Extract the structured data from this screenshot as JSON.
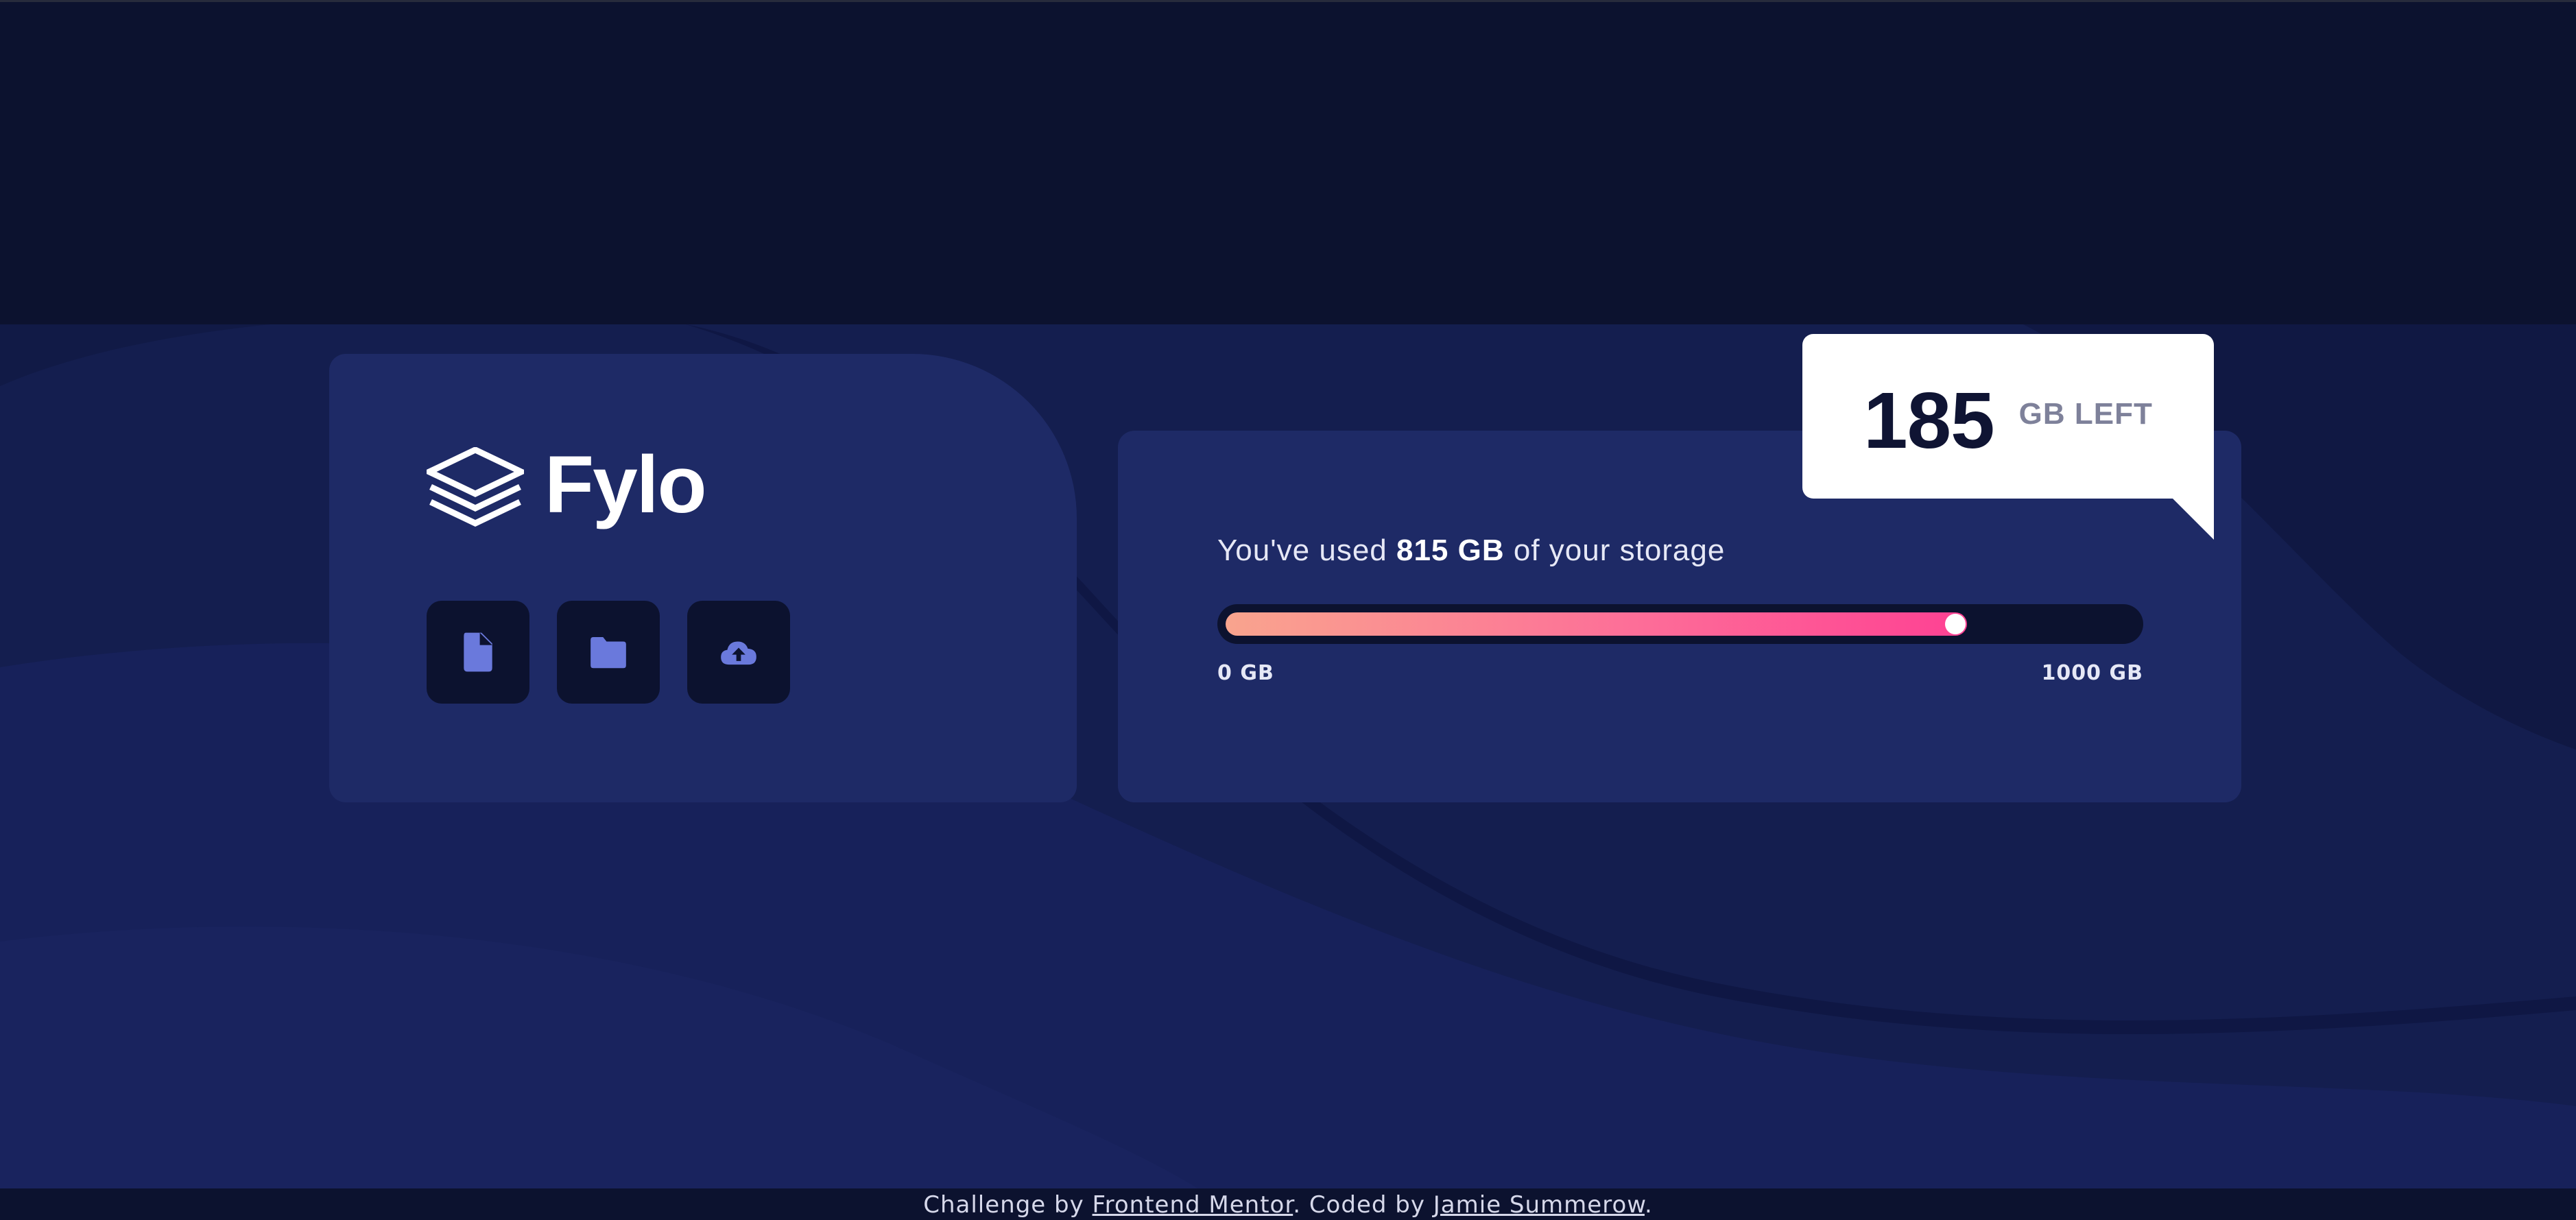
{
  "brand": {
    "name": "Fylo",
    "logo_icon": "stacked-layers-icon"
  },
  "actions": [
    {
      "name": "document",
      "icon": "document-icon"
    },
    {
      "name": "folder",
      "icon": "folder-icon"
    },
    {
      "name": "upload",
      "icon": "cloud-upload-icon"
    }
  ],
  "storage": {
    "used_prefix": "You've used ",
    "used_amount": "815 GB",
    "used_suffix": " of your storage",
    "used_fraction": 0.815,
    "min_label": "0 GB",
    "max_label": "1000 GB",
    "left_number": "185",
    "left_label": "GB LEFT"
  },
  "footer": {
    "prefix": "Challenge by ",
    "link1": "Frontend Mentor",
    "middle": ". Coded by ",
    "link2": "Jamie Summerow",
    "suffix": "."
  },
  "colors": {
    "background": "#0c122f",
    "card": "#1e2a66",
    "icon": "#6a79dc",
    "gradient_start": "#f9a48e",
    "gradient_end": "#fe4193"
  }
}
